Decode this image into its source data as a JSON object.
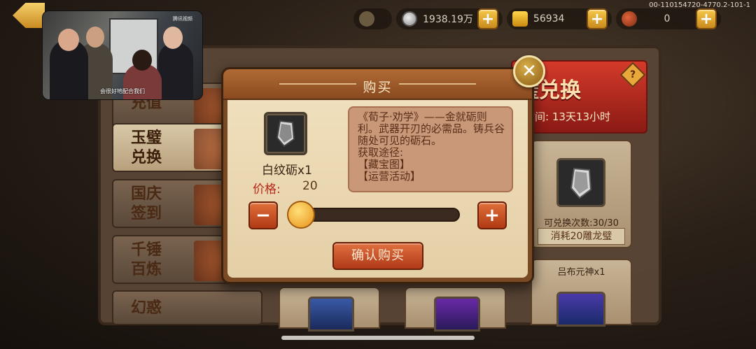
{
  "server_id": "00-110154720-4770.2-101-1",
  "resources": [
    {
      "icon": "silver-coin-icon",
      "value": "1938.19万"
    },
    {
      "icon": "gold-ingot-icon",
      "value": "56934"
    },
    {
      "icon": "meat-icon",
      "value": "0"
    }
  ],
  "video": {
    "subtitle": "会很好地配合我们",
    "watermark": "腾讯视频"
  },
  "tabs": [
    {
      "label_line1": "充值",
      "label_line2": ""
    },
    {
      "label_line1": "玉璧",
      "label_line2": "兑换"
    },
    {
      "label_line1": "国庆",
      "label_line2": "签到"
    },
    {
      "label_line1": "千锤",
      "label_line2": "百炼"
    },
    {
      "label_line1": "幻惑",
      "label_line2": ""
    }
  ],
  "banner": {
    "title": "璧兑换",
    "time_text": "余时间: 13天13小时",
    "help": "?"
  },
  "shop_card": {
    "count": "可兑换次数:30/30",
    "cost": "消耗20雕龙璧"
  },
  "shop_card2": {
    "name": "吕布元神x1"
  },
  "dialog": {
    "title": "购买",
    "close": "✕",
    "item_name": "白纹砺x1",
    "price_label": "价格:",
    "price_value": "20",
    "description": [
      "《荀子·劝学》——金就砺则利。武器开刃的必需品。铸兵谷随处可见的砺石。",
      "获取途径:",
      "【藏宝图】",
      "【运营活动】"
    ],
    "minus": "−",
    "plus": "+",
    "confirm": "确认购买"
  },
  "slider": {
    "position": 0
  },
  "colors": {
    "accent": "#b03a18",
    "panel": "#f0dfbc",
    "price": "#b8281a"
  }
}
